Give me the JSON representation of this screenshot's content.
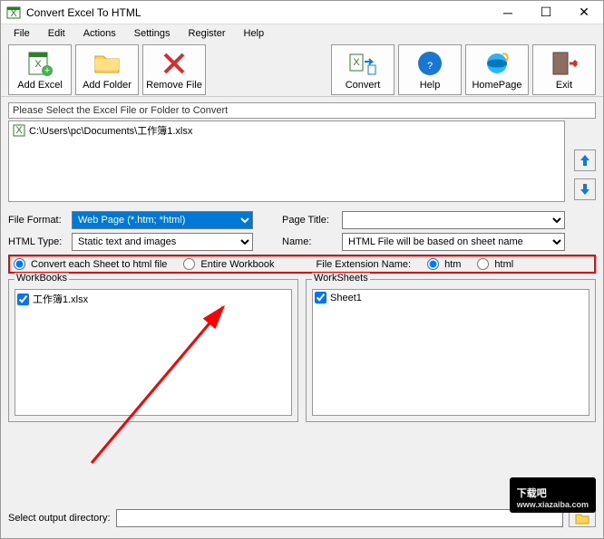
{
  "window": {
    "title": "Convert Excel To HTML"
  },
  "menu": {
    "file": "File",
    "edit": "Edit",
    "actions": "Actions",
    "settings": "Settings",
    "register": "Register",
    "help": "Help"
  },
  "toolbar": {
    "add_excel": "Add Excel",
    "add_folder": "Add Folder",
    "remove_file": "Remove File",
    "convert": "Convert",
    "help": "Help",
    "homepage": "HomePage",
    "exit": "Exit"
  },
  "instruction": "Please Select the Excel File or Folder to Convert",
  "file_path": "C:\\Users\\pc\\Documents\\工作簿1.xlsx",
  "labels": {
    "file_format": "File Format:",
    "html_type": "HTML Type:",
    "page_title": "Page Title:",
    "name": "Name:",
    "file_ext": "File Extension Name:",
    "workbooks": "WorkBooks",
    "worksheets": "WorkSheets",
    "output_dir": "Select  output directory:"
  },
  "selects": {
    "file_format_value": "Web Page (*.htm; *html)",
    "html_type_value": "Static text and images",
    "name_value": "HTML File will be based on sheet name",
    "page_title_value": ""
  },
  "radios": {
    "each_sheet": "Convert each Sheet to html file",
    "entire_wb": "Entire Workbook",
    "htm": "htm",
    "html": "html"
  },
  "workbooks": [
    {
      "name": "工作簿1.xlsx",
      "checked": true
    }
  ],
  "worksheets": [
    {
      "name": "Sheet1",
      "checked": true
    }
  ],
  "output_dir_value": "",
  "watermark": {
    "main": "下载吧",
    "sub": "www.xiazaiba.com"
  }
}
